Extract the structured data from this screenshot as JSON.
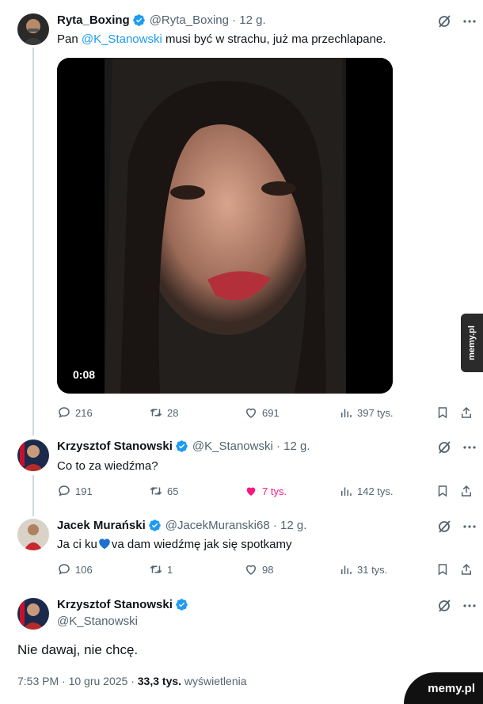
{
  "tweet1": {
    "name": "Ryta_Boxing",
    "handle_time": "@Ryta_Boxing · 12 g.",
    "text_pre": "Pan ",
    "mention": "@K_Stanowski",
    "text_post": " musi być w strachu, już ma przechlapane.",
    "video_time": "0:08",
    "replies": "216",
    "reposts": "28",
    "likes": "691",
    "views": "397 tys."
  },
  "tweet2": {
    "name": "Krzysztof Stanowski",
    "handle_time": "@K_Stanowski · 12 g.",
    "text": "Co to za wiedźma?",
    "replies": "191",
    "reposts": "65",
    "likes": "7 tys.",
    "views": "142 tys."
  },
  "tweet3": {
    "name": "Jacek Murański",
    "handle_time": "@JacekMuranski68 · 12 g.",
    "text_pre": "Ja ci ku",
    "text_post": "va dam wiedźmę jak się spotkamy",
    "replies": "106",
    "reposts": "1",
    "likes": "98",
    "views": "31 tys."
  },
  "tweet4": {
    "name": "Krzysztof Stanowski",
    "handle": "@K_Stanowski",
    "text": "Nie dawaj, nie chcę.",
    "timestamp": "7:53 PM · 10 gru 2025 · ",
    "views_count": "33,3 tys.",
    "views_label": " wyświetlenia"
  },
  "watermark": "memy.pl",
  "colors": {
    "accent": "#1d9bf0",
    "like": "#f91880",
    "muted": "#536471",
    "verified": "#1d9bf0"
  }
}
